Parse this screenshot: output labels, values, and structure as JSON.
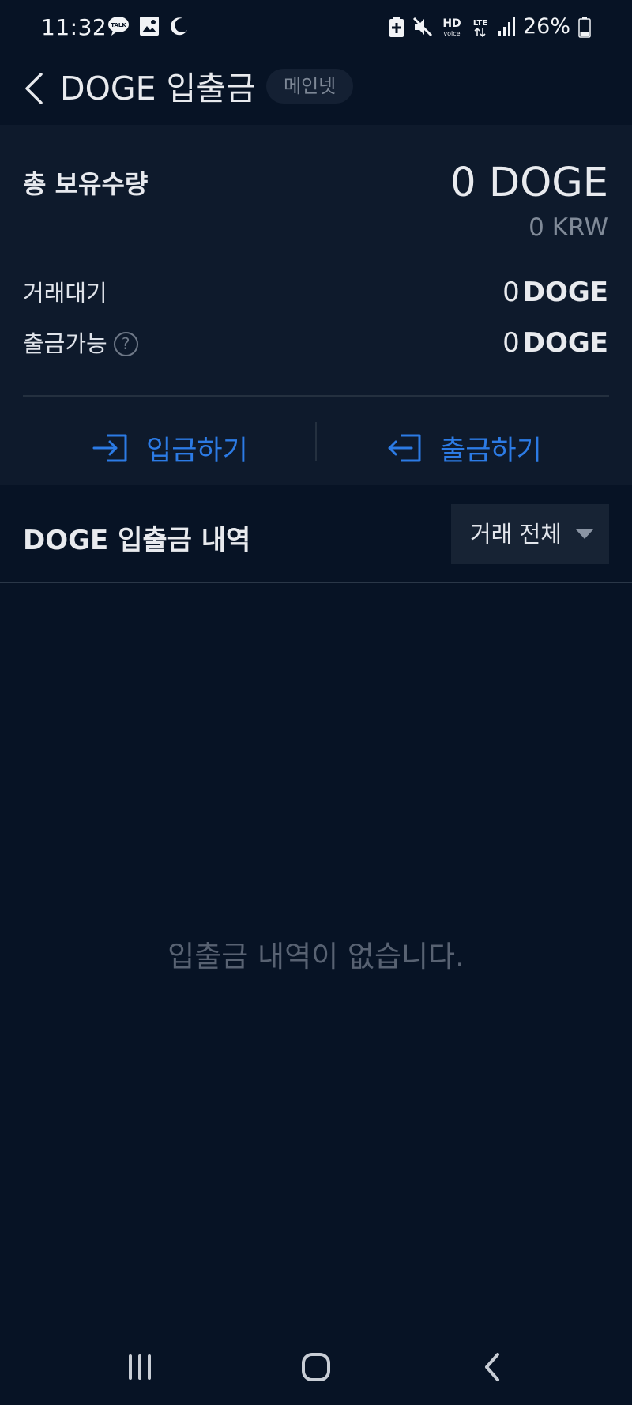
{
  "status_bar": {
    "time": "11:32",
    "battery": "26%",
    "left_icons": [
      "kakaotalk-icon",
      "gallery-icon",
      "moon-icon"
    ],
    "right_icons": [
      "battery-saver-icon",
      "mute-icon",
      "hd-voice-icon",
      "lte-icon",
      "signal-icon",
      "battery-icon"
    ],
    "talk_text": "TALK",
    "hd_text": "HD",
    "voice_text": "voice",
    "lte_text": "LTE"
  },
  "header": {
    "title": "DOGE 입출금",
    "badge": "메인넷"
  },
  "summary": {
    "total_label": "총 보유수량",
    "total_amount": "0 DOGE",
    "total_krw": "0 KRW",
    "pending_label": "거래대기",
    "pending_value": "0",
    "pending_unit": "DOGE",
    "withdrawable_label": "출금가능",
    "withdrawable_value": "0",
    "withdrawable_unit": "DOGE",
    "help_glyph": "?"
  },
  "actions": {
    "deposit_label": "입금하기",
    "withdraw_label": "출금하기",
    "accent_color": "#2c7be5"
  },
  "history": {
    "title": "DOGE 입출금 내역",
    "filter_selected": "거래 전체",
    "empty_message": "입출금 내역이 없습니다."
  },
  "nav_bar": {
    "icons": [
      "recent-apps-icon",
      "home-icon",
      "back-icon"
    ]
  }
}
